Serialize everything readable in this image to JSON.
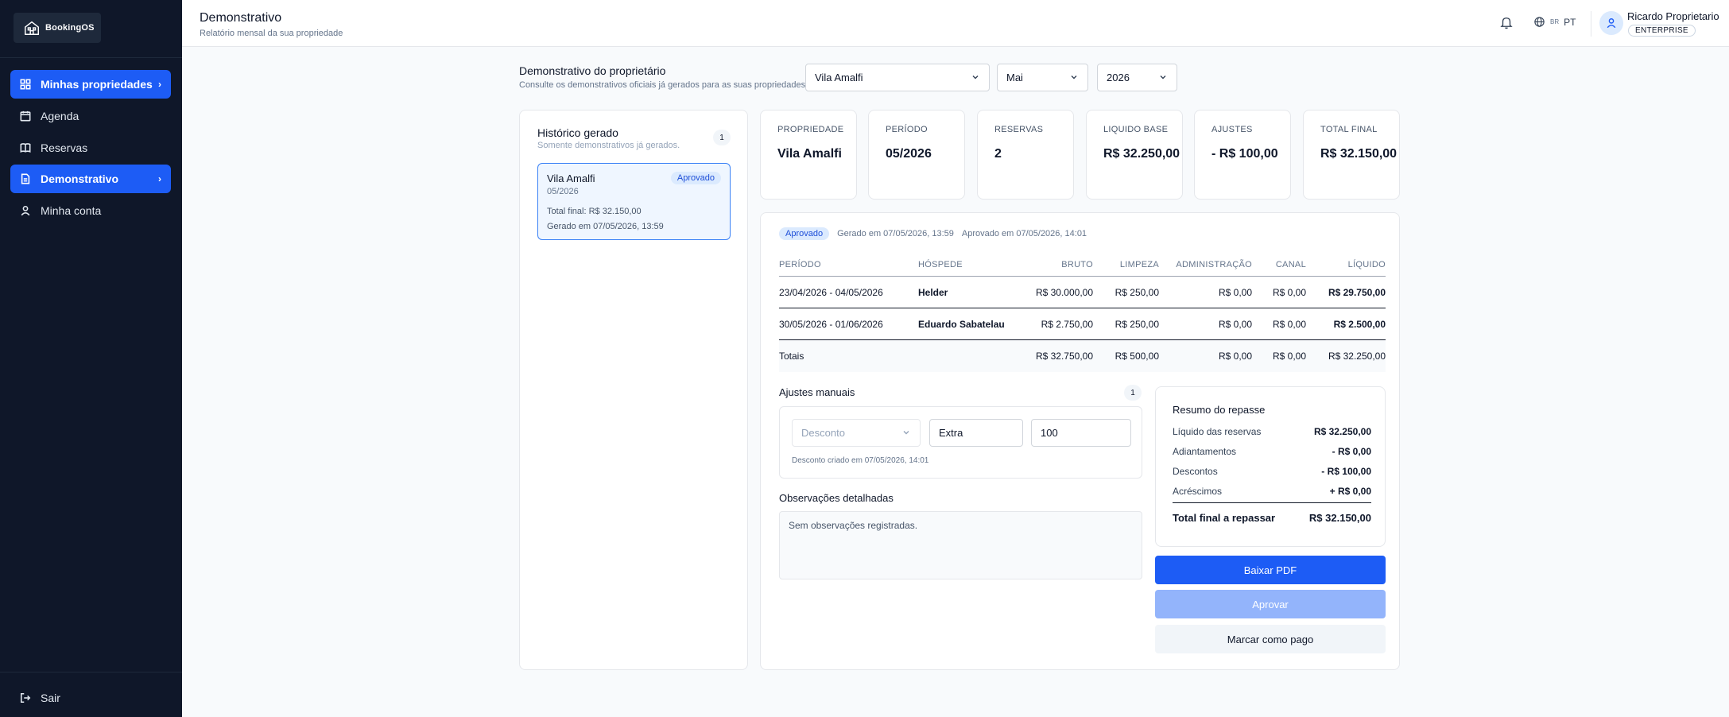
{
  "app": {
    "name": "BookingOS"
  },
  "sidebar": {
    "items": [
      {
        "label": "Minhas propriedades",
        "icon": "grid-icon"
      },
      {
        "label": "Agenda",
        "icon": "calendar-icon"
      },
      {
        "label": "Reservas",
        "icon": "book-icon"
      },
      {
        "label": "Demonstrativo",
        "icon": "document-icon"
      },
      {
        "label": "Minha conta",
        "icon": "user-icon"
      }
    ],
    "logout": "Sair"
  },
  "header": {
    "title": "Demonstrativo",
    "subtitle": "Relatório mensal da sua propriedade",
    "lang_flag": "BR",
    "lang": "PT",
    "user_name": "Ricardo Proprietario",
    "user_plan": "ENTERPRISE"
  },
  "filters": {
    "title": "Demonstrativo do proprietário",
    "subtitle": "Consulte os demonstrativos oficiais já gerados para as suas propriedades.",
    "property": "Vila Amalfi",
    "month": "Mai",
    "year": "2026"
  },
  "history": {
    "title": "Histórico gerado",
    "subtitle": "Somente demonstrativos já gerados.",
    "count": "1",
    "item": {
      "name": "Vila Amalfi",
      "period": "05/2026",
      "status": "Aprovado",
      "total": "Total final: R$ 32.150,00",
      "generated": "Gerado em 07/05/2026, 13:59"
    }
  },
  "kpis": [
    {
      "label": "PROPRIEDADE",
      "value": "Vila Amalfi"
    },
    {
      "label": "PERÍODO",
      "value": "05/2026"
    },
    {
      "label": "RESERVAS",
      "value": "2"
    },
    {
      "label": "LIQUIDO BASE",
      "value": "R$ 32.250,00"
    },
    {
      "label": "AJUSTES",
      "value": "- R$ 100,00"
    },
    {
      "label": "TOTAL FINAL",
      "value": "R$ 32.150,00"
    }
  ],
  "detail": {
    "status": "Aprovado",
    "generated": "Gerado em 07/05/2026, 13:59",
    "approved": "Aprovado em 07/05/2026, 14:01",
    "table": {
      "headers": {
        "period": "PERÍODO",
        "guest": "HÓSPEDE",
        "bruto": "BRUTO",
        "limpeza": "LIMPEZA",
        "admin": "ADMINISTRAÇÃO",
        "canal": "CANAL",
        "liquido": "LÍQUIDO"
      },
      "rows": [
        {
          "period": "23/04/2026 - 04/05/2026",
          "guest": "Helder",
          "bruto": "R$ 30.000,00",
          "limpeza": "R$ 250,00",
          "admin": "R$ 0,00",
          "canal": "R$ 0,00",
          "liquido": "R$ 29.750,00"
        },
        {
          "period": "30/05/2026 - 01/06/2026",
          "guest": "Eduardo Sabatelau",
          "bruto": "R$ 2.750,00",
          "limpeza": "R$ 250,00",
          "admin": "R$ 0,00",
          "canal": "R$ 0,00",
          "liquido": "R$ 2.500,00"
        }
      ],
      "totals": {
        "label": "Totais",
        "bruto": "R$ 32.750,00",
        "limpeza": "R$ 500,00",
        "admin": "R$ 0,00",
        "canal": "R$ 0,00",
        "liquido": "R$ 32.250,00"
      }
    },
    "adjustments": {
      "title": "Ajustes manuais",
      "count": "1",
      "type": "Desconto",
      "description": "Extra",
      "amount": "100",
      "note": "Desconto criado em 07/05/2026, 14:01"
    },
    "observations": {
      "title": "Observações detalhadas",
      "text": "Sem observações registradas."
    },
    "summary": {
      "title": "Resumo do repasse",
      "rows": [
        {
          "label": "Líquido das reservas",
          "value": "R$ 32.250,00"
        },
        {
          "label": "Adiantamentos",
          "value": "- R$ 0,00"
        },
        {
          "label": "Descontos",
          "value": "- R$ 100,00"
        },
        {
          "label": "Acréscimos",
          "value": "+ R$ 0,00"
        }
      ],
      "total_label": "Total final a repassar",
      "total_value": "R$ 32.150,00"
    },
    "actions": {
      "download": "Baixar PDF",
      "approve": "Aprovar",
      "mark_paid": "Marcar como pago"
    }
  },
  "colors": {
    "accent": "#1d5cf5",
    "sidebar_bg": "#0f1729",
    "badge_bg": "#dbeafe",
    "badge_text": "#1d4ed8"
  }
}
